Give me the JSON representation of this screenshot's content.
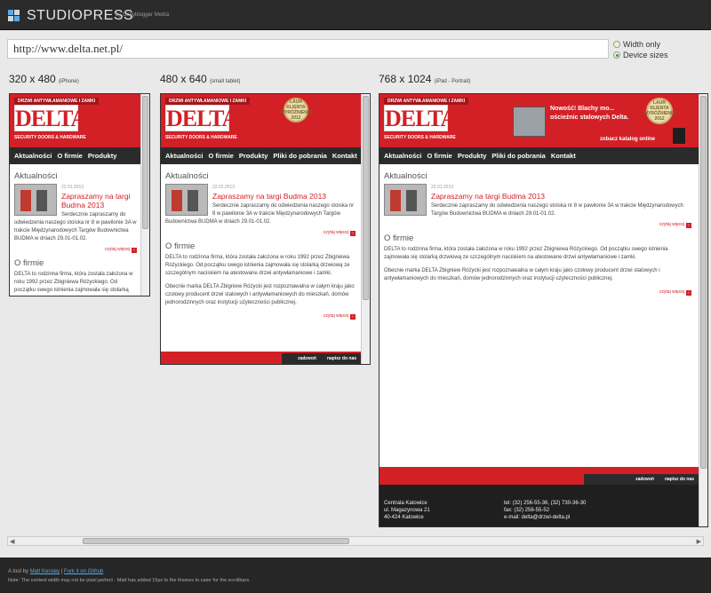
{
  "app": {
    "brand": "STUDIOPRESS",
    "byline": "by Copyblogger Media",
    "logo_colors": [
      "#5aa9e6",
      "#cfd8dc",
      "#cfd8dc",
      "#5aa9e6"
    ]
  },
  "url": {
    "value": "http://www.delta.net.pl/"
  },
  "options": {
    "width_only": "Width only",
    "device_sizes": "Device sizes",
    "selected": "Device sizes"
  },
  "devices": [
    {
      "size": "320 x 480",
      "name": "(iPhone)"
    },
    {
      "size": "480 x 640",
      "name": "(small tablet)"
    },
    {
      "size": "768 x 1024",
      "name": "(iPad - Portrait)"
    }
  ],
  "site": {
    "strip": "DRZWI ANTYWŁAMANIOWE I ZAMKI",
    "logo": "DELTA",
    "security": "SECURITY DOORS & HARDWARE",
    "medal": "LAUR KLIENTA WYRÓŻNIENIE 2012",
    "promo": "Nowość! Blachy mo... ościeżnic stalowych Delta.",
    "catalog": "zobacz katalog online",
    "nav": [
      "Aktualności",
      "O firmie",
      "Produkty",
      "Pliki do pobrania",
      "Kontakt"
    ],
    "section_news": "Aktualności",
    "post": {
      "date": "22.01.2013",
      "title": "Zapraszamy na targi Budma 2013",
      "excerpt": "Serdecznie zapraszamy do odwiedzenia naszego stoiska nr 8 w pawilonie 3A w trakcie Międzynarodowych Targów Budownictwa BUDMA w dniach 29.01-01.02."
    },
    "read_more": "czytaj więcej",
    "section_about": "O firmie",
    "about_p1": "DELTA to rodzinna firma, która została założona w roku 1992 przez Zbigniewa Różyckiego. Od początku swego istnienia zajmowała się stolarką drzwiową ze szczególnym naciskiem na atestowane drzwi antywłamaniowe i zamki.",
    "about_p2": "Obecnie marka DELTA Zbigniew Różycki jest rozpoznawalna w całym kraju jako czołowy producent drzwi stalowych i antywłamaniowych do mieszkań, domów jednorodzinnych oraz instytucji użyteczności publicznej.",
    "footer_links": [
      "zadzwoń",
      "napisz do nas"
    ],
    "contact": {
      "office": "Centrala Katowice",
      "street": "ul. Magazynowa 21",
      "city": "40-424 Katowice",
      "tel": "tel: (32) 256-55-36, (32) 730-36-30",
      "fax": "fax: (32) 256-55-52",
      "email": "e-mail: delta@drzwi-delta.pl"
    }
  },
  "credits": {
    "prefix": "A tool by",
    "author": "Matt Kersley",
    "separator": "|",
    "fork": "Fork it on Github",
    "note": "Note: The content width may not be pixel perfect - Matt has added 15px to the iframes to cater for the scrollbars."
  },
  "colors": {
    "brand_red": "#d32027",
    "dark": "#2b2b2b",
    "link_blue": "#63a7d8"
  }
}
